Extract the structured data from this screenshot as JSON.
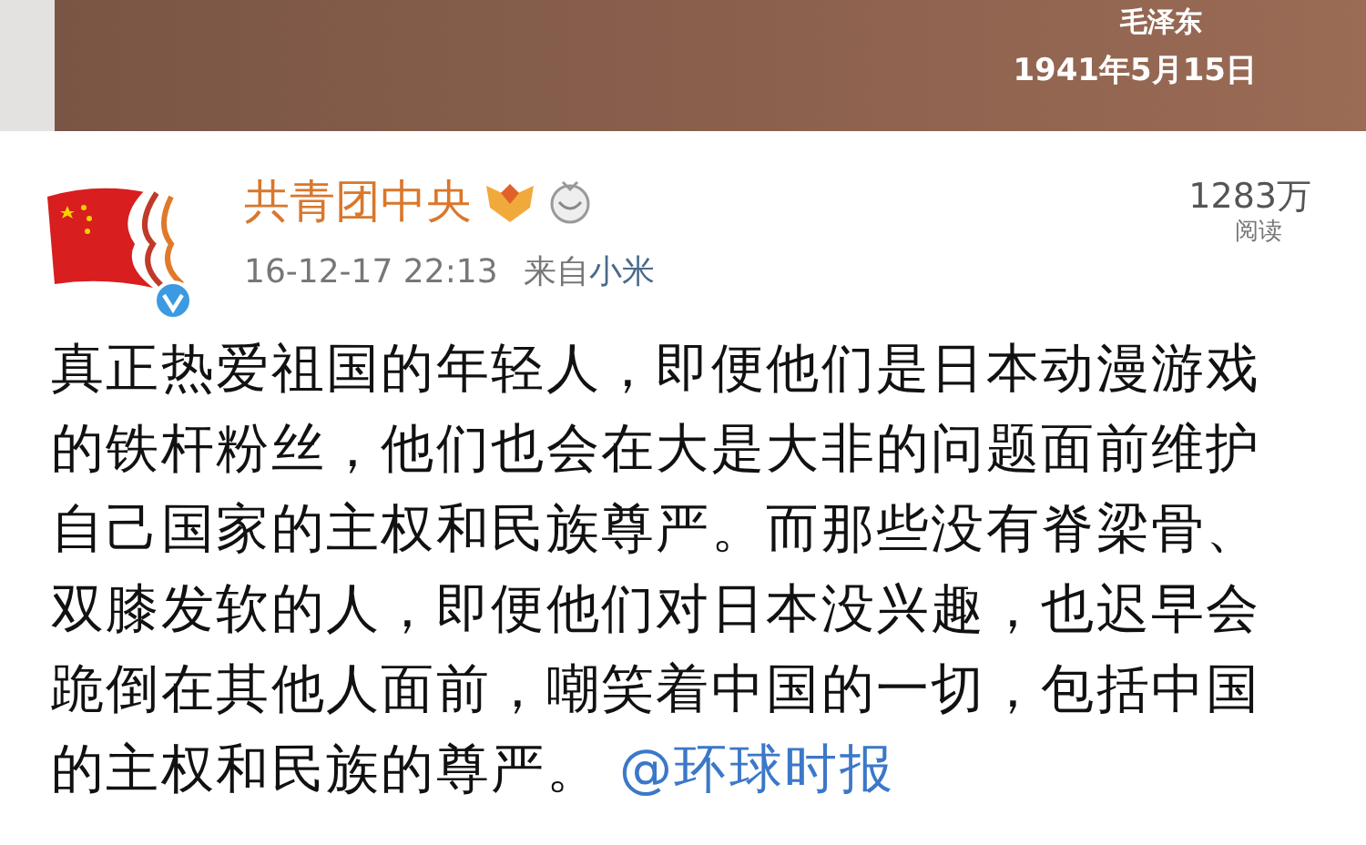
{
  "banner": {
    "author": "毛泽东",
    "date": "1941年5月15日"
  },
  "post": {
    "author": "共青团中央",
    "verified": true,
    "timestamp": "16-12-17 22:13",
    "source_prefix": "来自",
    "source": "小米",
    "read_count": "1283万",
    "read_label": "阅读",
    "body": "真正热爱祖国的年轻人，即便他们是日本动漫游戏的铁杆粉丝，他们也会在大是大非的问题面前维护自己国家的主权和民族尊严。而那些没有脊梁骨、双膝发软的人，即便他们对日本没兴趣，也迟早会跪倒在其他人面前，嘲笑着中国的一切，包括中国的主权和民族的尊严。",
    "mention": "@环球时报"
  }
}
